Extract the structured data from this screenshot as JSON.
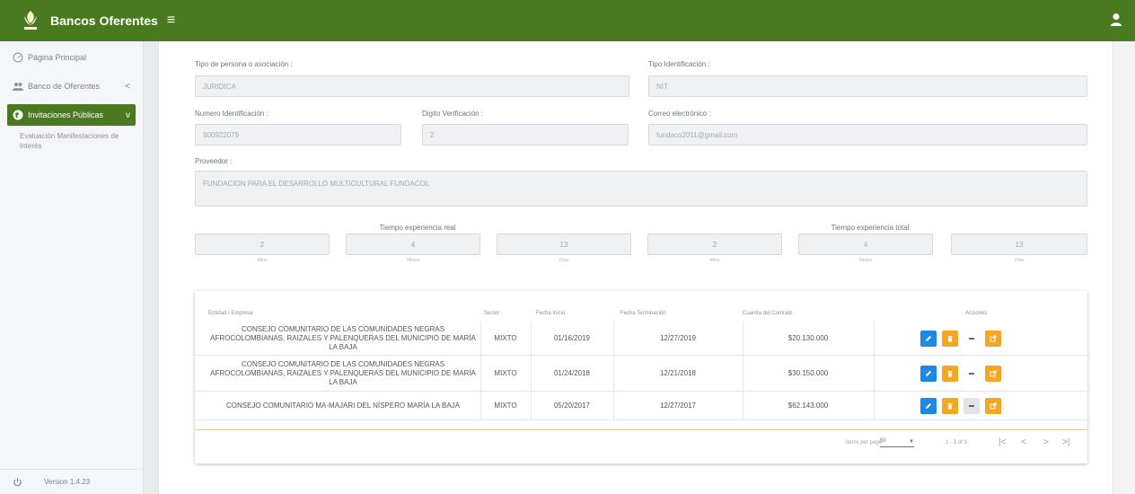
{
  "app": {
    "title": "Bancos Oferentes",
    "menu_glyph": "≡",
    "brand_color": "#4a7a1f"
  },
  "sidebar": {
    "items": [
      {
        "label": "Página Principal",
        "icon": "dashboard-icon"
      },
      {
        "label": "Banco de Oferentes",
        "icon": "users-icon",
        "chevron": "<"
      },
      {
        "label": "Invitaciones Públicas",
        "icon": "globe-icon",
        "chevron": "v",
        "active": true
      }
    ],
    "sub_item": "Evaluación Manifestaciones de Interés",
    "version": "Version 1.4.23"
  },
  "form": {
    "tipo_persona_label": "Tipo de persona o asociación :",
    "tipo_persona_value": "JURIDICA",
    "tipo_ident_label": "Tipo Identificación :",
    "tipo_ident_value": "NIT",
    "numero_ident_label": "Numero Identificación :",
    "numero_ident_value": "900922079",
    "digito_label": "Digito Verificación :",
    "digito_value": "2",
    "correo_label": "Correo electrónico :",
    "correo_value": "fundaco2011@gmail.com",
    "proveedor_label": "Proveedor :",
    "proveedor_value": "FUNDACION PARA EL DESARROLLO MULTICULTURAL FUNDACOL"
  },
  "experiencia": {
    "real_title": "Tiempo experiencia real",
    "total_title": "Tiempo experiencia total",
    "real": [
      {
        "value": "2",
        "unit": "Años"
      },
      {
        "value": "4",
        "unit": "Meses"
      },
      {
        "value": "13",
        "unit": "Días"
      }
    ],
    "total": [
      {
        "value": "2",
        "unit": "Años"
      },
      {
        "value": "4",
        "unit": "Meses"
      },
      {
        "value": "13",
        "unit": "Días"
      }
    ]
  },
  "table": {
    "headers": [
      "Entidad / Empresa",
      "Sector",
      "Fecha Inicio",
      "Fecha Terminación",
      "Cuantía del Contrato",
      "Acciones"
    ],
    "rows": [
      {
        "entidad": "CONSEJO COMUNITARIO DE LAS COMUNIDADES NEGRAS AFROCOLOMBIANAS, RAIZALES Y PALENQUERAS DEL MUNICIPIO DE MARÍA LA BAJA",
        "sector": "MIXTO",
        "inicio": "01/16/2019",
        "fin": "12/27/2019",
        "cuantia": "$20.130.000"
      },
      {
        "entidad": "CONSEJO COMUNITARIO DE LAS COMUNIDADES NEGRAS AFROCOLOMBIANAS, RAIZALES Y PALENQUERAS DEL MUNICIPIO DE MARÍA LA BAJA",
        "sector": "MIXTO",
        "inicio": "01/24/2018",
        "fin": "12/21/2018",
        "cuantia": "$30.150.000"
      },
      {
        "entidad": "CONSEJO COMUNITARIO MA-MAJARI DEL NÍSPERO MARÍA LA BAJA",
        "sector": "MIXTO",
        "inicio": "05/20/2017",
        "fin": "12/27/2017",
        "cuantia": "$62.143.000"
      }
    ],
    "action_colors": {
      "edit": "#1e88e5",
      "delete": "#f5a623",
      "open": "#f5a623"
    }
  },
  "pagination": {
    "items_per_page_label": "Items per page:",
    "items_per_page_value": "50",
    "range": "1 - 3 of 3",
    "first": "|<",
    "prev": "<",
    "next": ">",
    "last": ">|"
  }
}
